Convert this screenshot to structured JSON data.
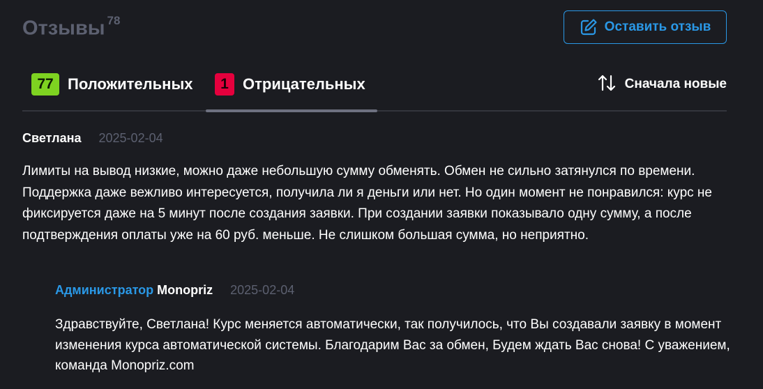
{
  "header": {
    "title": "Отзывы",
    "total_count": "78",
    "leave_review_label": "Оставить отзыв",
    "leave_review_icon": "edit-icon"
  },
  "tabs": [
    {
      "count": "77",
      "label": "Положительных",
      "badge_color": "#7ed321",
      "active": false
    },
    {
      "count": "1",
      "label": "Отрицательных",
      "badge_color": "#e5003d",
      "active": true
    }
  ],
  "sort": {
    "icon": "sort-arrows-icon",
    "label": "Сначала новые"
  },
  "reviews": [
    {
      "author": "Светлана",
      "date": "2025-02-04",
      "text": "Лимиты на вывод низкие, можно даже небольшую сумму обменять. Обмен не сильно затянулся по времени. Поддержка даже вежливо интересуется, получила ли я деньги или нет. Но один момент не понравился: курс не фиксируется даже на 5 минут после создания заявки. При создании заявки показывало одну сумму, а после подтверждения оплаты уже на 60 руб. меньше. Не слишком большая сумма, но неприятно.",
      "reply": {
        "role": "Администратор",
        "name": "Monopriz",
        "date": "2025-02-04",
        "text": "Здравствуйте, Светлана! Курс меняется автоматически, так получилось, что Вы создавали заявку в момент изменения курса автоматической системы. Благодарим Вас за обмен, Будем ждать Вас снова! С уважением, команда Monopriz.com"
      }
    }
  ],
  "colors": {
    "background": "#1b1c21",
    "accent": "#2a98e6",
    "muted": "#5c6070",
    "positive": "#7ed321",
    "negative": "#e5003d"
  }
}
